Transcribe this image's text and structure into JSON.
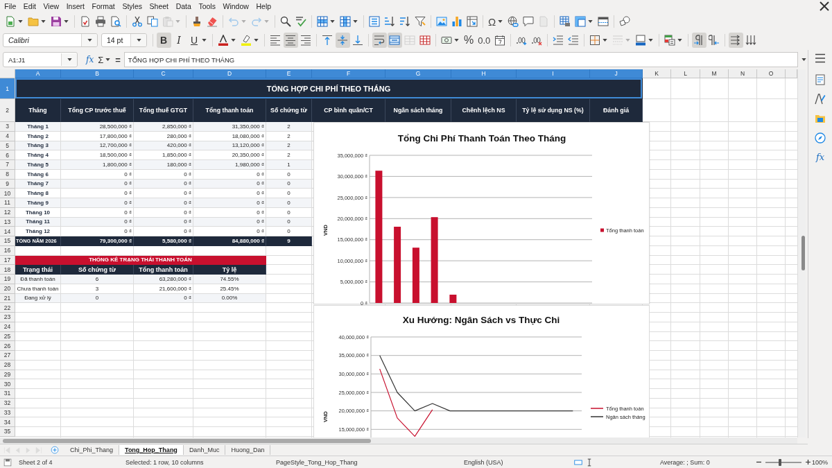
{
  "menu_bar": {
    "items": [
      "File",
      "Edit",
      "View",
      "Insert",
      "Format",
      "Styles",
      "Sheet",
      "Data",
      "Tools",
      "Window",
      "Help"
    ]
  },
  "standard_toolbar": {
    "paste": {
      "disabled": true
    },
    "undo": {
      "disabled": true
    },
    "redo": {
      "disabled": true
    },
    "special_character": {
      "label": "Ω"
    },
    "headers_footers": {
      "disabled": true
    }
  },
  "formatting_toolbar": {
    "font_name": "Calibri",
    "font_size": "14 pt",
    "bold": {
      "label": "B",
      "on": true
    },
    "italic": {
      "label": "I",
      "on": false
    },
    "underline": {
      "label": "U",
      "on": false
    },
    "align_left": {
      "on": false
    },
    "align_center": {
      "on": true
    },
    "align_right": {
      "on": false
    },
    "align_top": {
      "on": false
    },
    "align_middle": {
      "on": true
    },
    "align_bottom": {
      "on": false
    },
    "wrap_text": {
      "on": true
    },
    "merge_and_center": {
      "on": true
    },
    "merge_cells": {
      "disabled": true
    },
    "percent": {
      "label": "%"
    },
    "number_format": {
      "label": "0.0"
    },
    "border_style": {
      "disabled": true
    },
    "left_to_right": {
      "on": true
    },
    "right_to_left": {
      "on": false
    },
    "text_left_to_right": {
      "on": true
    },
    "text_top_to_bottom": {
      "on": false
    }
  },
  "formula_bar": {
    "name_box": "A1:J1",
    "function_wizard": "fx",
    "sum": "Σ",
    "formula": "=",
    "content": "TỔNG HỢP CHI PHÍ THEO THÁNG"
  },
  "sidebar": {
    "functions": "fx"
  },
  "column_headers": [
    {
      "label": "A",
      "selected": true
    },
    {
      "label": "B",
      "selected": true
    },
    {
      "label": "C",
      "selected": true
    },
    {
      "label": "D",
      "selected": true
    },
    {
      "label": "E",
      "selected": true
    },
    {
      "label": "F",
      "selected": true
    },
    {
      "label": "G",
      "selected": true
    },
    {
      "label": "H",
      "selected": true
    },
    {
      "label": "I",
      "selected": true
    },
    {
      "label": "J",
      "selected": true
    },
    {
      "label": "K",
      "selected": false
    },
    {
      "label": "L",
      "selected": false
    },
    {
      "label": "M",
      "selected": false
    },
    {
      "label": "N",
      "selected": false
    },
    {
      "label": "O",
      "selected": false
    }
  ],
  "row_headers": [
    {
      "label": "1",
      "selected": true
    },
    {
      "label": "2",
      "selected": false
    },
    {
      "label": "3",
      "selected": false
    },
    {
      "label": "4",
      "selected": false
    },
    {
      "label": "5",
      "selected": false
    },
    {
      "label": "6",
      "selected": false
    },
    {
      "label": "7",
      "selected": false
    },
    {
      "label": "8",
      "selected": false
    },
    {
      "label": "9",
      "selected": false
    },
    {
      "label": "10",
      "selected": false
    },
    {
      "label": "11",
      "selected": false
    },
    {
      "label": "12",
      "selected": false
    },
    {
      "label": "13",
      "selected": false
    },
    {
      "label": "14",
      "selected": false
    },
    {
      "label": "15",
      "selected": false
    },
    {
      "label": "16",
      "selected": false
    },
    {
      "label": "17",
      "selected": false
    },
    {
      "label": "18",
      "selected": false
    },
    {
      "label": "19",
      "selected": false
    },
    {
      "label": "20",
      "selected": false
    },
    {
      "label": "21",
      "selected": false
    },
    {
      "label": "22",
      "selected": false
    },
    {
      "label": "23",
      "selected": false
    },
    {
      "label": "24",
      "selected": false
    },
    {
      "label": "25",
      "selected": false
    },
    {
      "label": "26",
      "selected": false
    },
    {
      "label": "27",
      "selected": false
    },
    {
      "label": "28",
      "selected": false
    },
    {
      "label": "29",
      "selected": false
    },
    {
      "label": "30",
      "selected": false
    },
    {
      "label": "31",
      "selected": false
    },
    {
      "label": "32",
      "selected": false
    },
    {
      "label": "33",
      "selected": false
    },
    {
      "label": "34",
      "selected": false
    },
    {
      "label": "35",
      "selected": false
    }
  ],
  "sheet": {
    "title": {
      "text": "TỔNG HỢP CHI PHÍ THEO THÁNG",
      "selected": true
    },
    "summary_table": {
      "columns": [
        "Tháng",
        "Tổng CP trước thuế",
        "Tổng thuế GTGT",
        "Tổng thanh toán",
        "Số chứng từ",
        "CP bình quân/CT",
        "Ngân sách tháng",
        "Chênh lệch NS",
        "Tỷ lệ sử dụng NS (%)",
        "Đánh giá"
      ],
      "rows": [
        [
          "Tháng 1",
          "28,500,000 ₫",
          "2,850,000 ₫",
          "31,350,000 ₫",
          "2"
        ],
        [
          "Tháng 2",
          "17,800,000 ₫",
          "280,000 ₫",
          "18,080,000 ₫",
          "2"
        ],
        [
          "Tháng 3",
          "12,700,000 ₫",
          "420,000 ₫",
          "13,120,000 ₫",
          "2"
        ],
        [
          "Tháng 4",
          "18,500,000 ₫",
          "1,850,000 ₫",
          "20,350,000 ₫",
          "2"
        ],
        [
          "Tháng 5",
          "1,800,000 ₫",
          "180,000 ₫",
          "1,980,000 ₫",
          "1"
        ],
        [
          "Tháng 6",
          "0 ₫",
          "0 ₫",
          "0 ₫",
          "0"
        ],
        [
          "Tháng 7",
          "0 ₫",
          "0 ₫",
          "0 ₫",
          "0"
        ],
        [
          "Tháng 8",
          "0 ₫",
          "0 ₫",
          "0 ₫",
          "0"
        ],
        [
          "Tháng 9",
          "0 ₫",
          "0 ₫",
          "0 ₫",
          "0"
        ],
        [
          "Tháng 10",
          "0 ₫",
          "0 ₫",
          "0 ₫",
          "0"
        ],
        [
          "Tháng 11",
          "0 ₫",
          "0 ₫",
          "0 ₫",
          "0"
        ],
        [
          "Tháng 12",
          "0 ₫",
          "0 ₫",
          "0 ₫",
          "0"
        ]
      ],
      "total": [
        "TỔNG NĂM 2026",
        "79,300,000 ₫",
        "5,580,000 ₫",
        "84,880,000 ₫",
        "9"
      ]
    },
    "status_table": {
      "title": "THỐNG KÊ TRẠNG THÁI THANH TOÁN",
      "columns": [
        "Trạng thái",
        "Số chứng từ",
        "Tổng thanh toán",
        "Tỷ lệ"
      ],
      "rows": [
        [
          "Đã thanh toán",
          "6",
          "63,280,000 ₫",
          "74.55%"
        ],
        [
          "Chưa thanh toán",
          "3",
          "21,600,000 ₫",
          "25.45%"
        ],
        [
          "Đang xử lý",
          "0",
          "0 ₫",
          "0.00%"
        ]
      ]
    }
  },
  "charts": [
    {
      "chart_data": {
        "type": "bar",
        "title": "Tổng Chi Phí Thanh Toán Theo Tháng",
        "ylabel": "VND",
        "series": [
          {
            "name": "Tổng thanh toán",
            "color": "#c8102e",
            "values": [
              31350000,
              18080000,
              13120000,
              20350000,
              1980000,
              0,
              0,
              0,
              0,
              0,
              0,
              0
            ]
          }
        ],
        "ylim": [
          0,
          35000000
        ],
        "yticks": [
          {
            "value": 0,
            "label": "0 ₫"
          },
          {
            "value": 5000000,
            "label": "5,000,000 ₫"
          },
          {
            "value": 10000000,
            "label": "10,000,000 ₫"
          },
          {
            "value": 15000000,
            "label": "15,000,000 ₫"
          },
          {
            "value": 20000000,
            "label": "20,000,000 ₫"
          },
          {
            "value": 25000000,
            "label": "25,000,000 ₫"
          },
          {
            "value": 30000000,
            "label": "30,000,000 ₫"
          },
          {
            "value": 35000000,
            "label": "35,000,000 ₫"
          }
        ],
        "grid": true,
        "legend": "right"
      }
    },
    {
      "chart_data": {
        "type": "line",
        "title": "Xu Hướng: Ngân Sách vs Thực Chi",
        "ylabel": "VND",
        "series": [
          {
            "name": "Tổng thanh toán",
            "color": "#c8102e",
            "values": [
              31350000,
              18080000,
              13120000,
              20350000,
              null,
              null,
              null,
              null,
              null,
              null,
              null,
              null
            ]
          },
          {
            "name": "Ngân sách tháng",
            "color": "#333333",
            "values": [
              35000000,
              25000000,
              20000000,
              22000000,
              20000000,
              20000000,
              20000000,
              20000000,
              20000000,
              20000000,
              20000000,
              20000000
            ]
          }
        ],
        "ylim": [
          12800000,
          40000000
        ],
        "yticks": [
          {
            "value": 15000000,
            "label": "15,000,000 ₫"
          },
          {
            "value": 20000000,
            "label": "20,000,000 ₫"
          },
          {
            "value": 25000000,
            "label": "25,000,000 ₫"
          },
          {
            "value": 30000000,
            "label": "30,000,000 ₫"
          },
          {
            "value": 35000000,
            "label": "35,000,000 ₫"
          },
          {
            "value": 40000000,
            "label": "40,000,000 ₫"
          }
        ],
        "grid": true,
        "legend": "right"
      }
    }
  ],
  "sheet_tabs": [
    {
      "label": "Chi_Phi_Thang",
      "selected": false
    },
    {
      "label": "Tong_Hop_Thang",
      "selected": true
    },
    {
      "label": "Danh_Muc",
      "selected": false
    },
    {
      "label": "Huong_Dan",
      "selected": false
    }
  ],
  "status_bar": {
    "sheet": "Sheet 2 of 4",
    "selection": "Selected: 1 row, 10 columns",
    "page_style": "PageStyle_Tong_Hop_Thang",
    "language": "English (USA)",
    "summary": "Average: ; Sum: 0",
    "zoom_slider": {
      "level": 0.4
    },
    "zoom": "100%"
  }
}
